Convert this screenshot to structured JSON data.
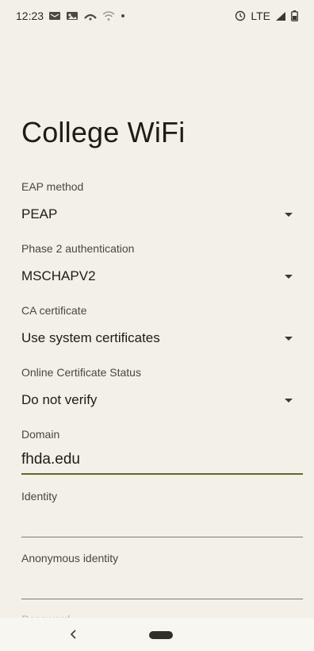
{
  "status_bar": {
    "time": "12:23",
    "network": "LTE"
  },
  "page": {
    "title": "College WiFi"
  },
  "form": {
    "eap_method": {
      "label": "EAP method",
      "value": "PEAP"
    },
    "phase2_auth": {
      "label": "Phase 2 authentication",
      "value": "MSCHAPV2"
    },
    "ca_certificate": {
      "label": "CA certificate",
      "value": "Use system certificates"
    },
    "online_cert_status": {
      "label": "Online Certificate Status",
      "value": "Do not verify"
    },
    "domain": {
      "label": "Domain",
      "value": "fhda.edu"
    },
    "identity": {
      "label": "Identity",
      "value": ""
    },
    "anonymous_identity": {
      "label": "Anonymous identity",
      "value": ""
    },
    "password": {
      "label": "Password"
    }
  },
  "nav_bar": {
    "back": "<"
  },
  "colors": {
    "background": "#f2f0e8",
    "accent": "#5f6a2a"
  },
  "icons": [
    "message-icon",
    "photo-icon",
    "hotspot-icon",
    "wifi-icon",
    "dot-icon",
    "alarm-icon",
    "signal-icon",
    "battery-icon",
    "back-icon"
  ]
}
